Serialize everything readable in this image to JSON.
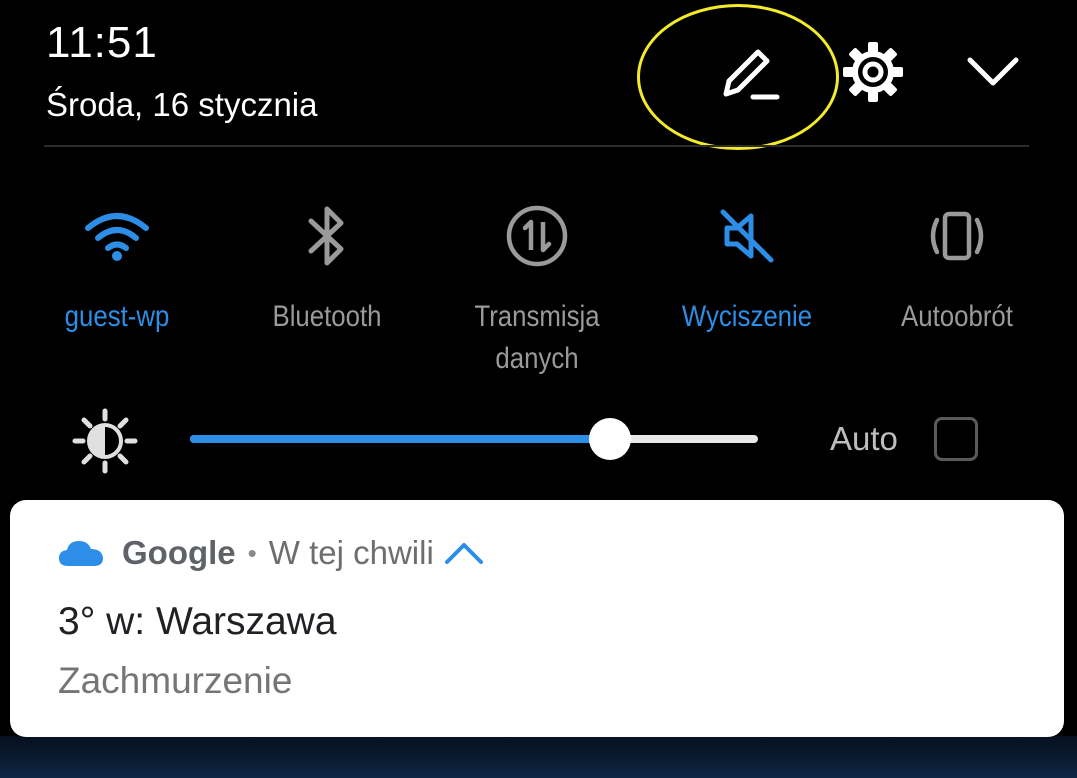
{
  "status": {
    "time": "11:51",
    "date": "Środa, 16 stycznia"
  },
  "header_actions": [
    {
      "name": "edit-icon",
      "highlighted": true
    },
    {
      "name": "gear-icon"
    },
    {
      "name": "chevron-down-icon"
    }
  ],
  "colors": {
    "accent": "#2c8ee6",
    "inactive": "#9a9a9a",
    "highlight_ring": "#f2ea2a",
    "background": "#000000",
    "card": "#ffffff"
  },
  "tiles": [
    {
      "label": "guest-wp",
      "icon": "wifi-icon",
      "active": true
    },
    {
      "label": "Bluetooth",
      "icon": "bluetooth-icon",
      "active": false
    },
    {
      "label": "Transmisja danych",
      "icon": "mobile-data-icon",
      "active": false
    },
    {
      "label": "Wyciszenie",
      "icon": "mute-icon",
      "active": true
    },
    {
      "label": "Autoobrót",
      "icon": "auto-rotate-icon",
      "active": false
    }
  ],
  "brightness": {
    "icon": "brightness-icon",
    "level_percent": 74,
    "auto_label": "Auto",
    "auto_checked": false
  },
  "notification": {
    "icon": "cloud-icon",
    "app": "Google",
    "separator": "•",
    "time": "W tej chwili",
    "title": "3° w: Warszawa",
    "text": "Zachmurzenie"
  }
}
